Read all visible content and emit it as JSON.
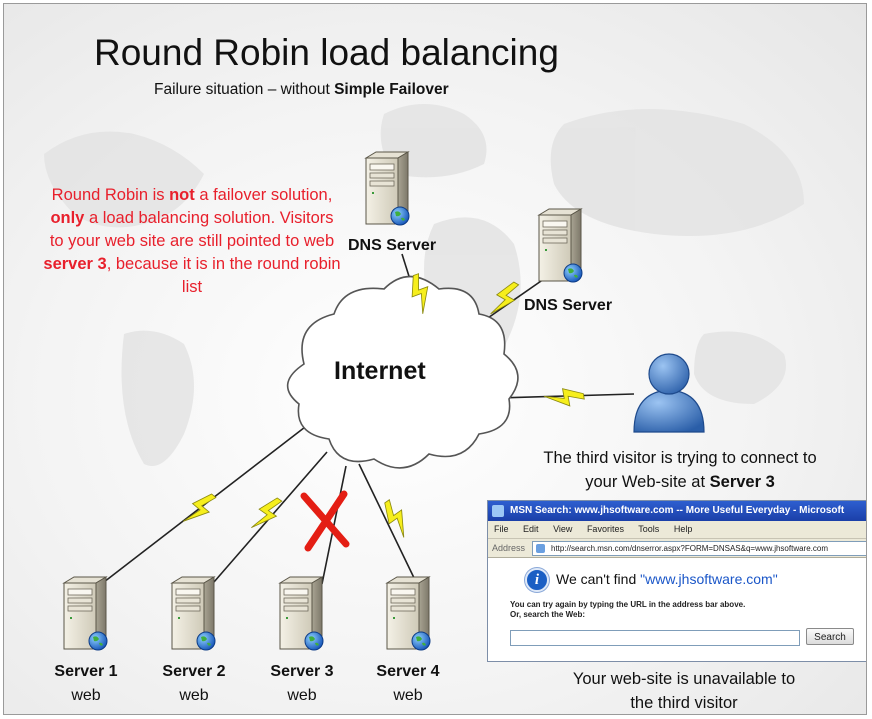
{
  "title": "Round Robin load balancing",
  "subtitle": {
    "text": "Failure situation – without ",
    "bold": "Simple Failover"
  },
  "note": {
    "p1": "Round Robin is ",
    "b1": "not",
    "p2": " a failover solution, ",
    "b2": "only",
    "p3": " a load balancing solution. Visitors to your web site are still pointed to web ",
    "b3": "server 3",
    "p4": ", because it is in the round robin list"
  },
  "dns_servers": [
    {
      "label": "DNS Server"
    },
    {
      "label": "DNS Server"
    }
  ],
  "internet_label": "Internet",
  "servers": [
    {
      "name": "Server 1",
      "role": "web",
      "failed": false
    },
    {
      "name": "Server 2",
      "role": "web",
      "failed": false
    },
    {
      "name": "Server 3",
      "role": "web",
      "failed": true
    },
    {
      "name": "Server 4",
      "role": "web",
      "failed": false
    }
  ],
  "visitor": {
    "line1": "The third visitor is trying to connect to",
    "line2_prefix": "your Web-site at ",
    "line2_bold": "Server 3"
  },
  "browser": {
    "title": "MSN Search: www.jhsoftware.com -- More Useful Everyday - Microsoft",
    "menu": [
      "File",
      "Edit",
      "View",
      "Favorites",
      "Tools",
      "Help"
    ],
    "address_label": "Address",
    "address_url": "http://search.msn.com/dnserror.aspx?FORM=DNSAS&q=www.jhsoftware.com",
    "error_prefix": "We can't find ",
    "error_domain": "\"www.jhsoftware.com\"",
    "hint_line1": "You can try again by typing the URL in the address bar above.",
    "hint_line2": "Or, search the Web:",
    "search_value": "",
    "search_button": "Search"
  },
  "unavailable": {
    "line1": "Your web-site is unavailable to",
    "line2": "the third visitor"
  },
  "colors": {
    "note_red": "#e8202c",
    "lightning_yellow": "#f6ee1c",
    "cross_red": "#e41e14",
    "info_blue": "#1b5fc4",
    "link_blue": "#1a56c8"
  }
}
